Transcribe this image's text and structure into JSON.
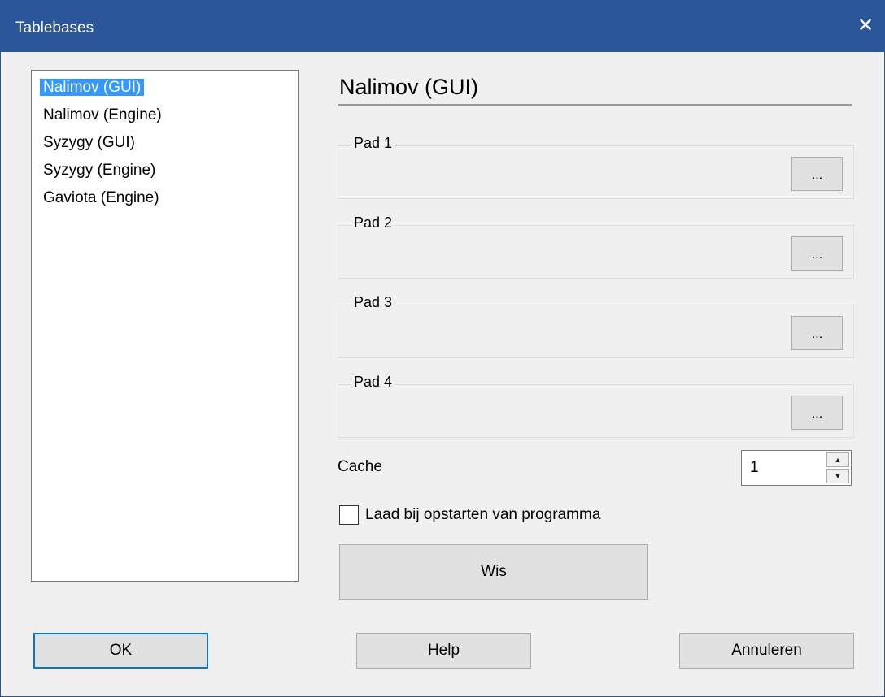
{
  "window": {
    "title": "Tablebases",
    "close_symbol": "✕",
    "titlebar_color": "#2b579a"
  },
  "list": {
    "items": [
      {
        "label": "Nalimov (GUI)",
        "selected": true
      },
      {
        "label": "Nalimov (Engine)",
        "selected": false
      },
      {
        "label": "Syzygy (GUI)",
        "selected": false
      },
      {
        "label": "Syzygy (Engine)",
        "selected": false
      },
      {
        "label": "Gaviota (Engine)",
        "selected": false
      }
    ],
    "selection_color": "#3399ff"
  },
  "panel": {
    "title": "Nalimov (GUI)",
    "paths": [
      {
        "label": "Pad 1",
        "value": "",
        "browse_label": "..."
      },
      {
        "label": "Pad 2",
        "value": "",
        "browse_label": "..."
      },
      {
        "label": "Pad 3",
        "value": "",
        "browse_label": "..."
      },
      {
        "label": "Pad 4",
        "value": "",
        "browse_label": "..."
      }
    ],
    "cache": {
      "label": "Cache",
      "value": "1"
    },
    "load_on_startup": {
      "label": "Laad bij opstarten van programma",
      "checked": false
    },
    "clear_label": "Wis"
  },
  "footer": {
    "ok_label": "OK",
    "help_label": "Help",
    "cancel_label": "Annuleren"
  }
}
